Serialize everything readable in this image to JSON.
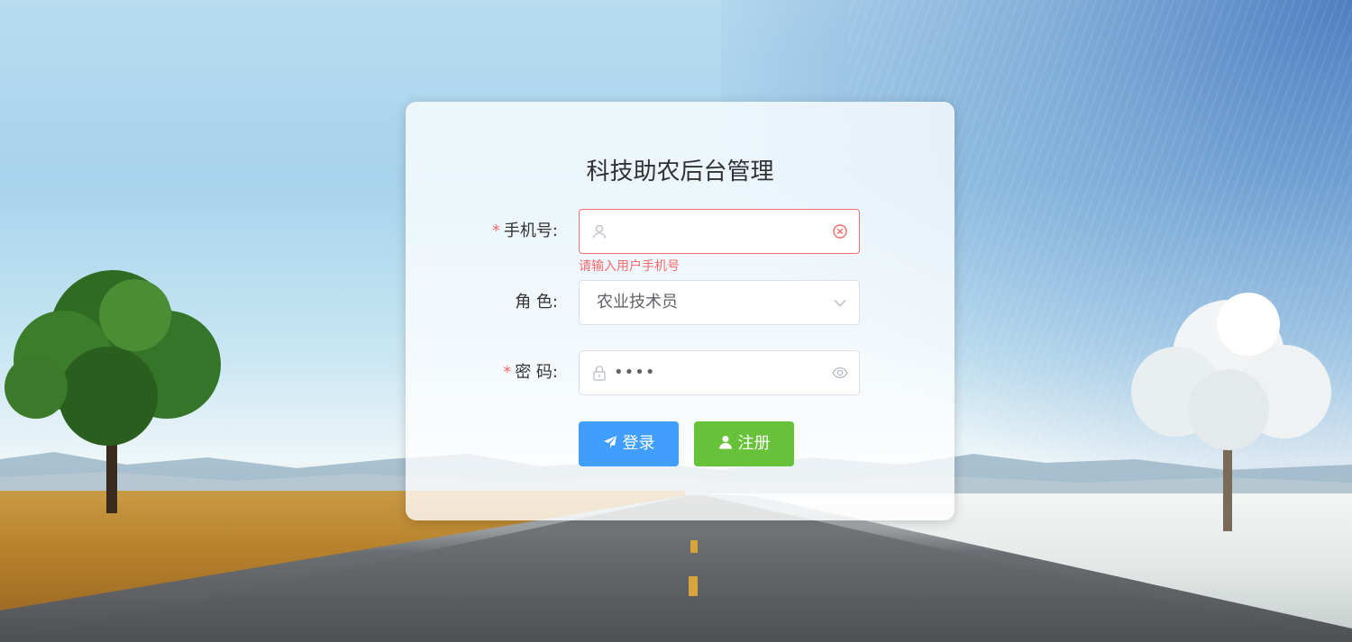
{
  "login_card": {
    "title": "科技助农后台管理",
    "phone": {
      "label": "手机号:",
      "required_mark": "*",
      "value": "",
      "error": "请输入用户手机号",
      "icon": "user-icon",
      "clear_icon": "circle-close-icon"
    },
    "role": {
      "label": "角 色:",
      "selected": "农业技术员",
      "icon": "chevron-down-icon"
    },
    "password": {
      "label": "密 码:",
      "required_mark": "*",
      "value": "••••",
      "icon": "lock-icon",
      "toggle_icon": "eye-icon"
    },
    "buttons": {
      "login": "登录",
      "login_icon": "paper-plane-icon",
      "register": "注册",
      "register_icon": "user-solid-icon"
    }
  },
  "colors": {
    "primary": "#409eff",
    "success": "#67c23a",
    "danger": "#f56c6c"
  }
}
